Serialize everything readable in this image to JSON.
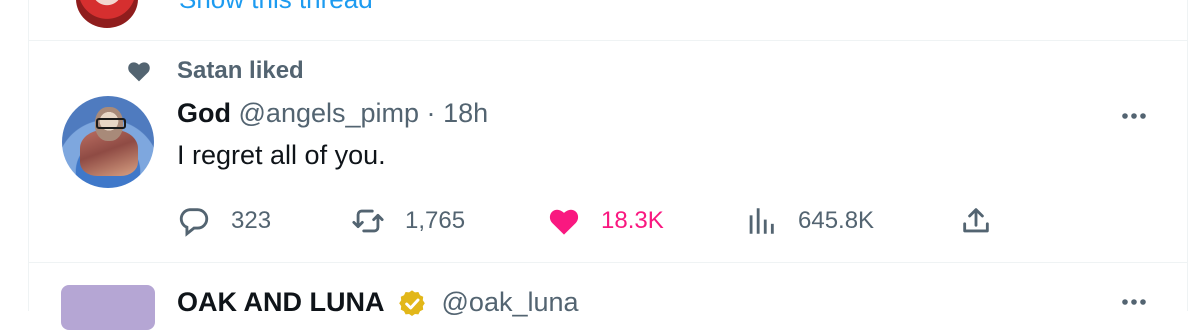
{
  "previous_tweet": {
    "show_thread_label": "Show this thread"
  },
  "tweet": {
    "social_context": "Satan liked",
    "author_name": "God",
    "author_handle": "@angels_pimp",
    "separator": "·",
    "timestamp": "18h",
    "text": "I regret all of you.",
    "replies": "323",
    "retweets": "1,765",
    "likes": "18.3K",
    "views": "645.8K",
    "liked": true
  },
  "next_tweet": {
    "author_name": "OAK AND LUNA",
    "author_handle": "@oak_luna"
  },
  "icons": {
    "social": "heart-filled-icon",
    "reply": "speech-bubble-icon",
    "retweet": "retweet-icon",
    "like": "heart-filled-icon",
    "views": "analytics-bars-icon",
    "share": "share-upload-icon",
    "more": "more-horizontal-icon",
    "verified": "gold-verified-badge-icon"
  },
  "colors": {
    "primary_text": "#0f1419",
    "secondary_text": "#536471",
    "link": "#1d9bf0",
    "like": "#f91880",
    "divider": "#eff3f4",
    "verified_gold": "#e2b719"
  }
}
